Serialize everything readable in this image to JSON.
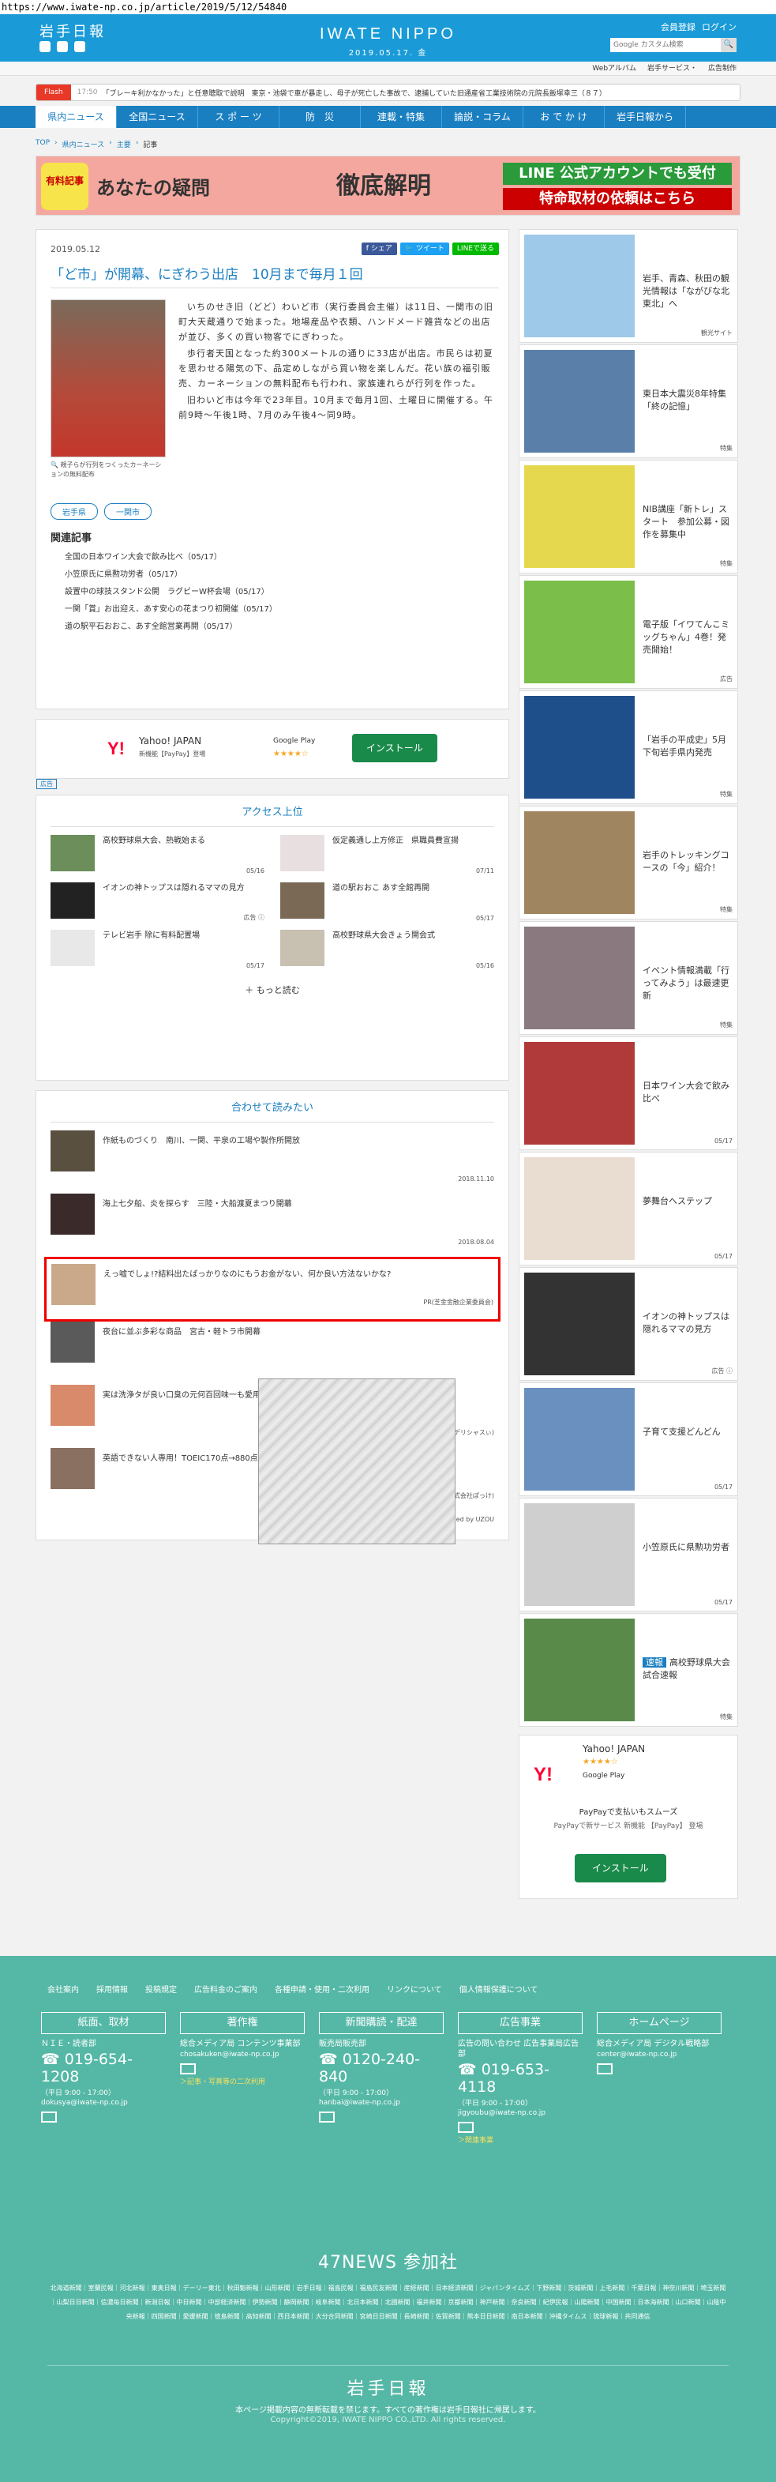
{
  "url": "https://www.iwate-np.co.jp/article/2019/5/12/54840",
  "header": {
    "logo": "岩手日報",
    "brand": "IWATE NIPPO",
    "date": "2019.05.17. 金",
    "member_reg": "会員登録",
    "login": "ログイン",
    "search_placeholder": "Google カスタム検索",
    "search_btn": "🔍"
  },
  "subnav": [
    "Webアルバム",
    "岩手サービス・",
    "広告制作"
  ],
  "flash": {
    "tag": "Flash",
    "time": "17:50",
    "text": "「ブレーキ利かなかった」と任意聴取で説明　東京・池袋で車が暴走し、母子が死亡した事故で、逮捕していた旧通産省工業技術院の元院長飯塚幸三（８７）"
  },
  "nav": [
    "県内ニュース",
    "全国ニュース",
    "ス ポ ー ツ",
    "防　災",
    "連載・特集",
    "論説・コラム",
    "お で か け",
    "岩手日報から"
  ],
  "breadcrumb": [
    "TOP",
    "県内ニュース",
    "主要",
    "記事"
  ],
  "banner": {
    "b1": "有料記事",
    "b2": "あなたの疑問",
    "b3": "徹底解明",
    "b4": "LINE 公式アカウントでも受付",
    "b5": "特命取材の依頼はこちら"
  },
  "article": {
    "date": "2019.05.12",
    "share": [
      "f シェア",
      "🐦 ツイート",
      "LINEで送る"
    ],
    "title": "「ど市」が開幕、にぎわう出店　10月まで毎月１回",
    "caption": "🔍 親子らが行列をつくったカーネーションの無料配布",
    "p1": "いちのせき旧（どど）わいど市（実行委員会主催）は11日、一関市の旧町大天蔵通りで始まった。地場産品や衣類、ハンドメード雑貨などの出店が並び、多くの買い物客でにぎわった。",
    "p2": "歩行者天国となった約300メートルの通りに33店が出店。市民らは初夏を思わせる陽気の下、品定めしながら買い物を楽しんだ。花い族の福引販売、カーネーションの無料配布も行われ、家族連れらが行列を作った。",
    "p3": "旧わいど市は今年で23年目。10月まで毎月1回、土曜日に開催する。午前9時〜午後1時、7月のみ午後4〜同9時。",
    "tags": [
      "岩手県",
      "一関市"
    ],
    "related_title": "関連記事",
    "related": [
      "全国の日本ワイン大会で飲み比べ（05/17）",
      "小笠原氏に県勲功労者（05/17）",
      "設置中の球技スタンド公開　ラグビーW杯会場（05/17）",
      "一関「賞」お出迎え、あす安心の花まつり初開催（05/17）",
      "道の駅平石おおこ、あす全館営業再開（05/17）"
    ]
  },
  "ad1": {
    "brand": "Y!",
    "title": "Yahoo! JAPAN",
    "sub": "新機能【PayPay】登場",
    "gp": "Google Play",
    "stars": "★★★★☆",
    "install": "インストール",
    "adtag": "広告"
  },
  "ranking": {
    "title": "アクセス上位",
    "items": [
      {
        "text": "高校野球県大会、熱戦始まる",
        "date": "05/16"
      },
      {
        "text": "仮定義通し上方修正　県職員費宣揚",
        "date": "07/11"
      },
      {
        "text": "イオンの神トップスは隠れるママの見方",
        "date": "広告 ⓘ"
      },
      {
        "text": "道の駅おおこ あす全館再開",
        "date": "05/17"
      },
      {
        "text": "テレビ岩手 除に有料配置場",
        "date": "05/17"
      },
      {
        "text": "高校野球県大会きょう開会式",
        "date": "05/16"
      }
    ],
    "more": "＋ もっと読む"
  },
  "reco": {
    "title": "合わせて読みたい",
    "items": [
      {
        "text": "作紙ものづくり　南川、一関、平泉の工場や製作所開放",
        "date": "2018.11.10"
      },
      {
        "text": "海上七夕船、炎を探らす　三陸・大船渡夏まつり開幕",
        "date": "2018.08.04"
      },
      {
        "text": "えっ嘘でしょ!?結料出たばっかりなのにもうお金がない、何か良い方法ないかな?",
        "date": "PR(芝金金融企業委員会)"
      },
      {
        "text": "夜台に並ぶ多彩な商品　宮古・軽トラ市開幕",
        "date": ""
      },
      {
        "text": "実は洗浄タが良い口臭の元何百回味一も愛用の口臭ケアにイイキ止まらず",
        "date": "PR(デリシャスぃ)"
      },
      {
        "text": "英語できない人専用！TOEIC170点→880点のスマホゲームが凄い",
        "date": "PR(株式会社ぽっけ)"
      }
    ],
    "by": "Recommended by UZOU"
  },
  "side": [
    {
      "text": "岩手、青森、秋田の観光情報は「ながびな北東北」へ",
      "sm": "観光サイト",
      "c": "#9ec9e8"
    },
    {
      "text": "東日本大震災8年特集「終の記憶」",
      "sm": "特集",
      "c": "#5a7fa8"
    },
    {
      "text": "NIB講座「新トレ」スタート　参加公募・図作を募集中",
      "sm": "特集",
      "c": "#e6d84e"
    },
    {
      "text": "電子版「イワてんこミッグちゃん」4巻！発売開始！",
      "sm": "広告",
      "c": "#7bbf4a"
    },
    {
      "text": "「岩手の平成史」5月下旬岩手県内発売",
      "sm": "特集",
      "c": "#1f4f8a"
    },
    {
      "text": "岩手のトレッキングコースの「今」紹介！",
      "sm": "特集",
      "c": "#a08660"
    },
    {
      "text": "イベント情報満載「行ってみよう」は最速更新",
      "sm": "特集",
      "c": "#8a7a80"
    },
    {
      "text": "日本ワイン大会で飲み比べ",
      "sm": "05/17",
      "c": "#b03a3a"
    },
    {
      "text": "夢舞台へステップ",
      "sm": "05/17",
      "c": "#e9dcd0"
    },
    {
      "text": "イオンの神トップスは隠れるママの見方",
      "sm": "広告 ⓘ",
      "c": "#333333"
    },
    {
      "text": "子育て支援どんどん",
      "sm": "05/17",
      "c": "#6a90c0"
    },
    {
      "text": "小笠原氏に県勲功労者",
      "sm": "05/17",
      "c": "#cfcfcf"
    },
    {
      "text": "高校野球県大会　試合速報",
      "sm": "特集",
      "c": "#5a8a4a",
      "badge": "速報"
    }
  ],
  "ad2": {
    "brand": "Y!",
    "title": "Yahoo! JAPAN",
    "stars": "★★★★☆",
    "gp": "Google Play",
    "l1": "PayPayで支払いもスムーズ",
    "l2": "PayPayで新サービス 新機能 【PayPay】 登場",
    "install": "インストール"
  },
  "footer": {
    "links": [
      "会社案内",
      "採用情報",
      "投稿規定",
      "広告料金のご案内",
      "各種申請・使用・二次利用",
      "リンクについて",
      "個人情報保護について"
    ],
    "cols": [
      {
        "h": "紙面、取材",
        "s": "ＮＩＥ・読者部",
        "ph": "☎ 019-654-1208",
        "sm": "（平日 9:00 - 17:00）",
        "em": "dokusya@iwate-np.co.jp",
        "lk": ""
      },
      {
        "h": "著作権",
        "s": "総合メディア局 コンテンツ事業部",
        "ph": "",
        "sm": "",
        "em": "chosakuken@iwate-np.co.jp",
        "lk": "＞記事・写真等の二次利用"
      },
      {
        "h": "新聞購読・配達",
        "s": "販売局販売部",
        "ph": "☎ 0120-240-840",
        "sm": "（平日 9:00 - 17:00）",
        "em": "hanbai@iwate-np.co.jp",
        "lk": ""
      },
      {
        "h": "広告事業",
        "s": "広告の問い合わせ 広告事業局広告部",
        "ph": "☎ 019-653-4118",
        "sm": "（平日 9:00 - 17:00）",
        "em": "jigyoubu@iwate-np.co.jp",
        "lk": "＞関連事業"
      },
      {
        "h": "ホームページ",
        "s": "総合メディア局 デジタル戦略部",
        "ph": "",
        "sm": "",
        "em": "center@iwate-np.co.jp",
        "lk": ""
      }
    ],
    "news47": "47NEWS 参加社",
    "members": "北海道新聞｜室蘭民報｜河北新報｜東奥日報｜デーリー東北｜秋田魁新報｜山形新聞｜岩手日報｜福島民報｜福島民友新聞｜産経新聞｜日本経済新聞｜ジャパンタイムズ｜下野新聞｜茨城新聞｜上毛新聞｜千葉日報｜神奈川新聞｜埼玉新聞｜山梨日日新聞｜信濃毎日新聞｜新潟日報｜中日新聞｜中部経済新聞｜伊勢新聞｜静岡新聞｜岐阜新聞｜北日本新聞｜北國新聞｜福井新聞｜京都新聞｜神戸新聞｜奈良新聞｜紀伊民報｜山陽新聞｜中国新聞｜日本海新聞｜山口新聞｜山陰中央新報｜四国新聞｜愛媛新聞｜徳島新聞｜高知新聞｜西日本新聞｜大分合同新聞｜宮崎日日新聞｜長崎新聞｜佐賀新聞｜熊本日日新聞｜南日本新聞｜沖縄タイムス｜琉球新報｜共同通信",
    "logo": "岩手日報",
    "note": "本ページ掲載内容の無断転載を禁じます。すべての著作権は岩手日報社に帰属します。",
    "copy": "Copyright©2019, IWATE NIPPO CO.,LTD. All rights reserved."
  }
}
